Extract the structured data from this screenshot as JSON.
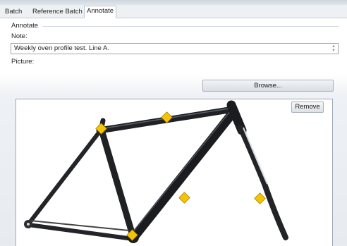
{
  "tabs": [
    {
      "label": "Batch",
      "active": false
    },
    {
      "label": "Reference Batch",
      "active": false
    },
    {
      "label": "Annotate",
      "active": true
    }
  ],
  "annotate": {
    "section_label": "Annotate",
    "note_label": "Note:",
    "note_value": "Weekly oven profile test. Line A.",
    "picture_label": "Picture:",
    "browse_label": "Browse...",
    "remove_label": "Remove"
  },
  "picture": {
    "subject": "bicycle frame with yellow diamond markers",
    "marker_color": "#f5c400",
    "marker_count": 5
  }
}
